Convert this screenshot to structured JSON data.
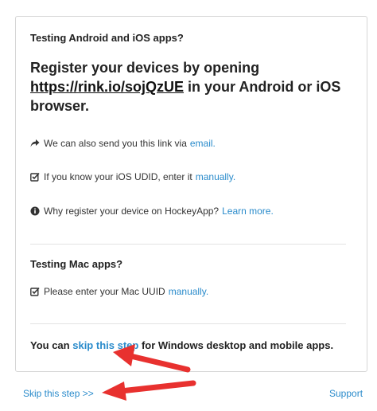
{
  "android_ios": {
    "heading": "Testing Android and iOS apps?",
    "register_prefix": "Register your devices by opening",
    "register_url": "https://rink.io/sojQzUE",
    "register_suffix": "in your Android or iOS browser.",
    "email_text": "We can also send you this link via",
    "email_link": "email.",
    "udid_text": "If you know your iOS UDID, enter it",
    "udid_link": "manually.",
    "why_text": "Why register your device on HockeyApp?",
    "why_link": "Learn more."
  },
  "mac": {
    "heading": "Testing Mac apps?",
    "uuid_text": "Please enter your Mac UUID",
    "uuid_link": "manually."
  },
  "windows": {
    "prefix": "You can",
    "link": "skip this step",
    "suffix": "for Windows desktop and mobile apps."
  },
  "footer": {
    "skip_label": "Skip this step >>",
    "support_label": "Support"
  },
  "colors": {
    "link": "#2a8bcb",
    "annotation_arrow": "#e8312f"
  },
  "icons": {
    "email": "share-arrow-icon",
    "udid": "edit-check-icon",
    "why": "info-circle-icon",
    "uuid": "edit-check-icon"
  }
}
